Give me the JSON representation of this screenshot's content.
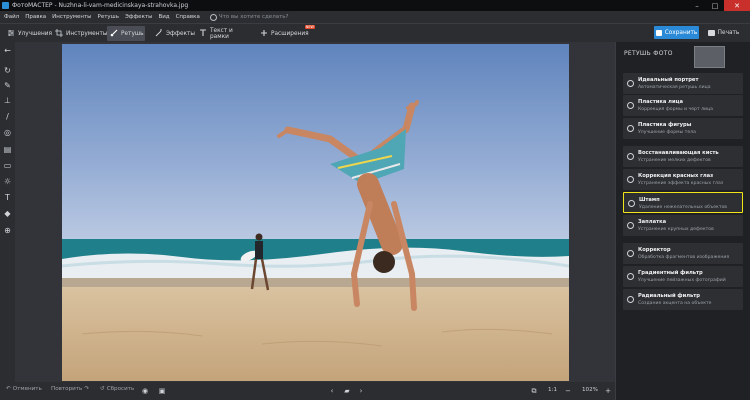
{
  "window": {
    "title": "ФотоМАСТЕР - Nuzhna-li-vam-medicinskaya-strahovka.jpg"
  },
  "menu": {
    "items": [
      "Файл",
      "Правка",
      "Инструменты",
      "Ретушь",
      "Эффекты",
      "Вид",
      "Справка"
    ],
    "search_placeholder": "Что вы хотите сделать?"
  },
  "toolbar": {
    "tabs": [
      {
        "label": "Улучшения",
        "icon": "sliders-icon"
      },
      {
        "label": "Инструменты",
        "icon": "crop-icon"
      },
      {
        "label": "Ретушь",
        "icon": "brush-icon"
      },
      {
        "label": "Эффекты",
        "icon": "magic-wand-icon"
      },
      {
        "label": "Текст и рамки",
        "icon": "text-icon"
      },
      {
        "label": "Расширения",
        "icon": "plus-icon",
        "badge": "NEW"
      }
    ],
    "active_tab": "Ретушь",
    "save_label": "Сохранить",
    "print_label": "Печать"
  },
  "right_panel": {
    "title": "РЕТУШЬ ФОТО",
    "tools": [
      {
        "title": "Идеальный портрет",
        "subtitle": "Автоматическая ретушь лица"
      },
      {
        "title": "Пластика лица",
        "subtitle": "Коррекция формы и черт лица"
      },
      {
        "title": "Пластика фигуры",
        "subtitle": "Улучшение формы тела"
      },
      {
        "title": "Восстанавливающая кисть",
        "subtitle": "Устранение мелких дефектов"
      },
      {
        "title": "Коррекция красных глаз",
        "subtitle": "Устранение эффекта красных глаз"
      },
      {
        "title": "Штамп",
        "subtitle": "Удаление нежелательных объектов",
        "highlighted": true
      },
      {
        "title": "Заплатка",
        "subtitle": "Устранение крупных дефектов"
      },
      {
        "title": "Корректор",
        "subtitle": "Обработка фрагментов изображения"
      },
      {
        "title": "Градиентный фильтр",
        "subtitle": "Улучшение пейзажных фотографий"
      },
      {
        "title": "Радиальный фильтр",
        "subtitle": "Создание акцента на объекте"
      }
    ]
  },
  "bottom_bar": {
    "undo_label": "Отменить",
    "redo_label": "Повторить",
    "reset_label": "Сбросить",
    "zoom_ratio": "1:1",
    "zoom_percent": "102%"
  },
  "colors": {
    "accent": "#2a8ad8",
    "highlight": "#f0e517"
  }
}
